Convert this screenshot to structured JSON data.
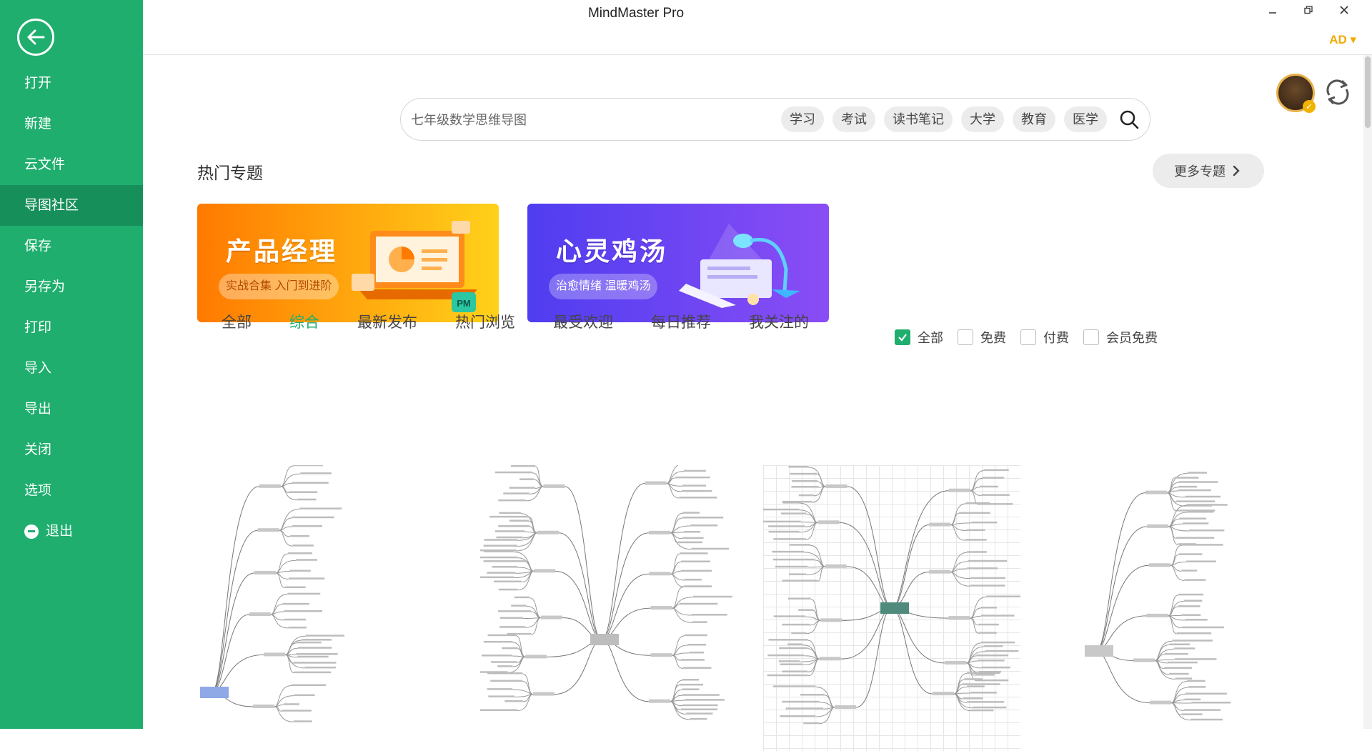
{
  "window": {
    "title": "MindMaster Pro",
    "account_label": "AD ▾"
  },
  "sidebar": {
    "items": [
      {
        "label": "打开"
      },
      {
        "label": "新建"
      },
      {
        "label": "云文件"
      },
      {
        "label": "导图社区",
        "active": true
      },
      {
        "label": "保存"
      },
      {
        "label": "另存为"
      },
      {
        "label": "打印"
      },
      {
        "label": "导入"
      },
      {
        "label": "导出"
      },
      {
        "label": "关闭"
      },
      {
        "label": "选项"
      },
      {
        "label": "退出",
        "icon": "minus-circle-icon"
      }
    ]
  },
  "search": {
    "placeholder": "七年级数学思维导图",
    "tags": [
      "学习",
      "考试",
      "读书笔记",
      "大学",
      "教育",
      "医学"
    ]
  },
  "hot_topics": {
    "title": "热门专题",
    "more_label": "更多专题",
    "banners": [
      {
        "title": "产品经理",
        "subtitle": "实战合集 入门到进阶",
        "badge": "PM",
        "colors": [
          "#ff7a00",
          "#ffd11a"
        ]
      },
      {
        "title": "心灵鸡汤",
        "subtitle": "治愈情绪 温暖鸡汤",
        "colors": [
          "#4f3df0",
          "#8a4df5"
        ]
      }
    ]
  },
  "filters": {
    "tabs": [
      "全部",
      "综合",
      "最新发布",
      "热门浏览",
      "最受欢迎",
      "每日推荐",
      "我关注的"
    ],
    "active_tab": "综合",
    "checkboxes": [
      {
        "label": "全部",
        "checked": true
      },
      {
        "label": "免费",
        "checked": false
      },
      {
        "label": "付费",
        "checked": false
      },
      {
        "label": "会员免费",
        "checked": false
      }
    ]
  },
  "colors": {
    "sidebar": "#1fae6e",
    "sidebar_active": "#178f5a",
    "accent": "#1fae6e",
    "account": "#f2a900"
  },
  "templates": [
    {
      "style": "plain"
    },
    {
      "style": "plain"
    },
    {
      "style": "grid"
    },
    {
      "style": "plain"
    }
  ]
}
